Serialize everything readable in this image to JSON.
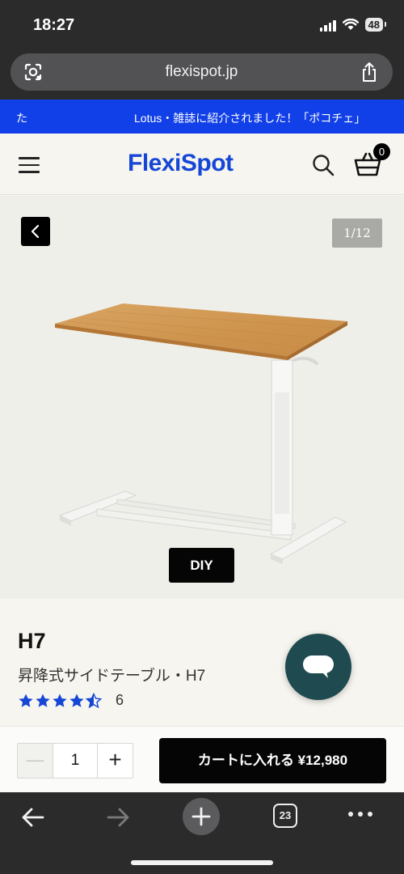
{
  "status_bar": {
    "time": "18:27",
    "battery": "48"
  },
  "browser": {
    "url": "flexispot.jp",
    "tab_count": "23"
  },
  "announcement": {
    "left_text": "た",
    "main_text": "Lotus・雑誌に紹介されました！「ポコチェ」"
  },
  "header": {
    "logo": "FlexiSpot",
    "cart_count": "0"
  },
  "gallery": {
    "counter": "1/12",
    "badge": "DIY"
  },
  "product": {
    "title": "H7",
    "subtitle": "昇降式サイドテーブル・H7",
    "rating": 4.5,
    "review_count": "6"
  },
  "purchase": {
    "minus_label": "—",
    "quantity": "1",
    "plus_label": "+",
    "add_to_cart_label": "カートに入れる ¥12,980"
  },
  "colors": {
    "brand_blue": "#1546d6",
    "announcement_bg": "#1240e8",
    "chat_bg": "#1f4a4f",
    "star": "#1546d6"
  }
}
